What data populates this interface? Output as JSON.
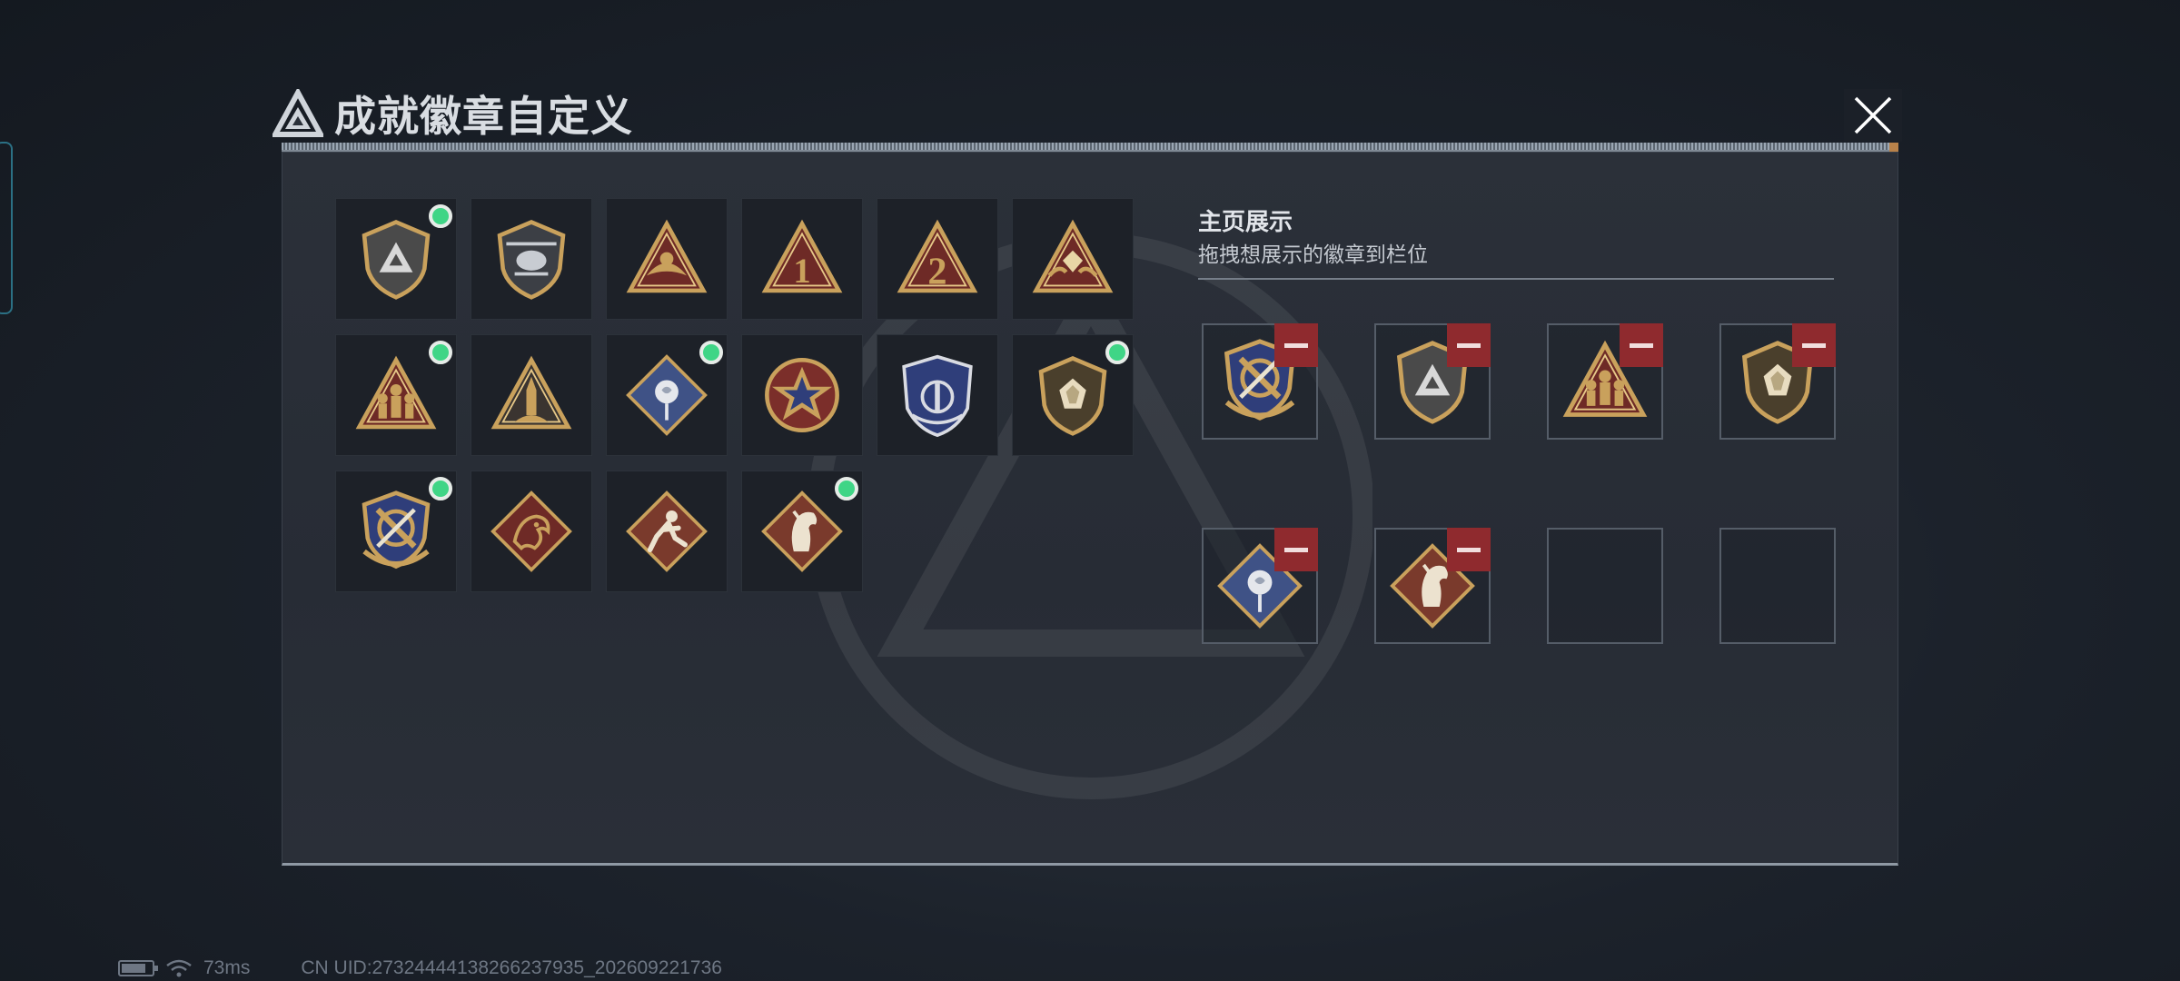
{
  "title": "成就徽章自定义",
  "showcase": {
    "title": "主页展示",
    "subtitle": "拖拽想展示的徽章到栏位"
  },
  "badges": [
    {
      "icon": "shield-triangle-badge-icon",
      "new": true
    },
    {
      "icon": "helicopter-shield-badge-icon",
      "new": false
    },
    {
      "icon": "triangle-wing-badge-icon",
      "new": false
    },
    {
      "icon": "triangle-number-1-badge-icon",
      "new": false
    },
    {
      "icon": "triangle-number-2-badge-icon",
      "new": false
    },
    {
      "icon": "triangle-hands-gem-badge-icon",
      "new": false
    },
    {
      "icon": "triangle-soldiers-badge-icon",
      "new": true
    },
    {
      "icon": "triangle-rocket-badge-icon",
      "new": false
    },
    {
      "icon": "diamond-rose-badge-icon",
      "new": true
    },
    {
      "icon": "star-medal-badge-icon",
      "new": false
    },
    {
      "icon": "blue-eagle-shield-badge-icon",
      "new": false
    },
    {
      "icon": "shield-gem-badge-icon",
      "new": true
    },
    {
      "icon": "crossed-weapons-shield-badge-icon",
      "new": true
    },
    {
      "icon": "diamond-dragon-badge-icon",
      "new": false
    },
    {
      "icon": "diamond-runner-badge-icon",
      "new": false
    },
    {
      "icon": "diamond-horse-badge-icon",
      "new": true
    }
  ],
  "slots": [
    {
      "icon": "crossed-weapons-shield-badge-icon",
      "filled": true
    },
    {
      "icon": "shield-triangle-badge-icon",
      "filled": true
    },
    {
      "icon": "triangle-soldiers-badge-icon",
      "filled": true
    },
    {
      "icon": "shield-gem-badge-icon",
      "filled": true
    },
    {
      "icon": "diamond-rose-badge-icon",
      "filled": true
    },
    {
      "icon": "diamond-horse-badge-icon",
      "filled": true
    },
    {
      "icon": "",
      "filled": false
    },
    {
      "icon": "",
      "filled": false
    }
  ],
  "status": {
    "ping": "73ms",
    "uid": "CN UID:2732444413826623793​5_202609221736"
  },
  "colors": {
    "gold": "#c9a15c",
    "new_dot": "#3fd586",
    "remove": "#8f2a2e",
    "blue": "#2f3e7a",
    "red": "#6e2a26"
  }
}
